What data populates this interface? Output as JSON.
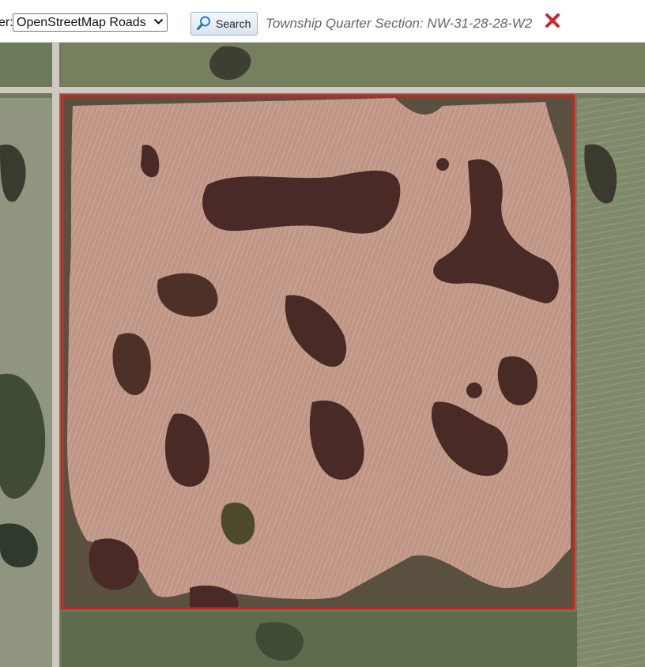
{
  "toolbar": {
    "layer_label": "er:",
    "layer_selected": "OpenStreetMap Roads",
    "search_label": "Search",
    "search_icon": "magnifier-icon",
    "section_text": "Township Quarter Section: NW-31-28-28-W2",
    "close_icon": "close-x-icon"
  },
  "colors": {
    "highlight_border": "#d42020",
    "field": "#c9a393",
    "slough": "#4a2a26",
    "grass": "#6f7b5a",
    "road": "#cfc9bf"
  }
}
